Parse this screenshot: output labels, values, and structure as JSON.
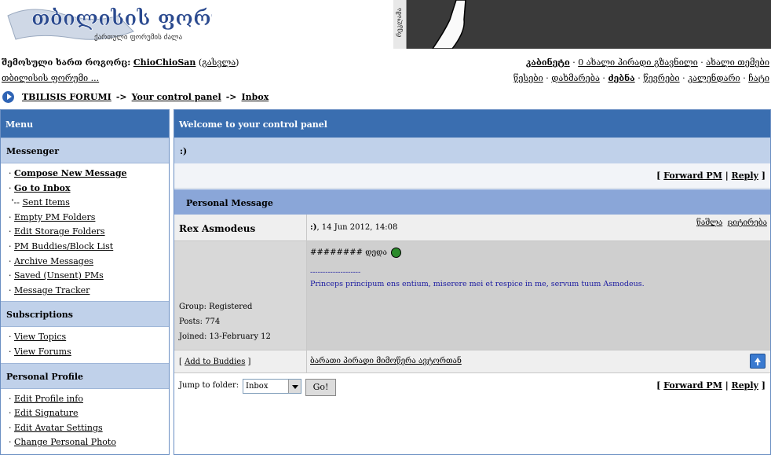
{
  "header": {
    "logo_title": "თბილისის ფორუმი",
    "logo_subtitle": "ქართული ფორუმის ძალა",
    "banner_tag": "რეკლამა"
  },
  "userbar": {
    "logged_prefix": "შემოსული ხართ როგორც:",
    "username": "ChioChioSan",
    "logout": "გასვლა",
    "forum_link": "თბილისის ფორუმი ...",
    "cabinet": "კაბინეტი",
    "new_pms": "0 ახალი პირადი გზავნილი",
    "new_topics": "ახალი თემები",
    "links": [
      "წესები",
      "დახმარება",
      "ძებნა",
      "წევრები",
      "კალენდარი",
      "ჩატი"
    ]
  },
  "breadcrumb": {
    "root": "TBILISIS FORUMI",
    "sep": "->",
    "cp": "Your control panel",
    "current": "Inbox"
  },
  "menu": {
    "title": "Menu",
    "sections": [
      {
        "title": "Messenger",
        "items": [
          "Compose New Message",
          "Go to Inbox",
          "Sent Items",
          "Empty PM Folders",
          "Edit Storage Folders",
          "PM Buddies/Block List",
          "Archive Messages",
          "Saved (Unsent) PMs",
          "Message Tracker"
        ]
      },
      {
        "title": "Subscriptions",
        "items": [
          "View Topics",
          "View Forums"
        ]
      },
      {
        "title": "Personal Profile",
        "items": [
          "Edit Profile info",
          "Edit Signature",
          "Edit Avatar Settings",
          "Change Personal Photo"
        ]
      }
    ]
  },
  "panel": {
    "title": "Welcome to your control panel",
    "subject": ":)",
    "forward": "Forward PM",
    "reply": "Reply",
    "section": "Personal Message",
    "author": "Rex Asmodeus",
    "msg_title": ":)",
    "date": "14 Jun 2012, 14:08",
    "delete": "წაშლა",
    "quote": "ციტირება",
    "group": "Group: Registered",
    "posts": "Posts: 774",
    "joined": "Joined: 13-February 12",
    "body": "######## დედა",
    "sig_line": "--------------------",
    "signature": "Princeps principum ens entium, miserere mei et respice in me, servum tuum Asmodeus.",
    "add_buddies": "Add to Buddies",
    "pm_author": "ბარათი პირადი მიმოწერა ავტორთან",
    "jump_label": "Jump to folder:",
    "folder": "Inbox",
    "go": "Go!"
  }
}
